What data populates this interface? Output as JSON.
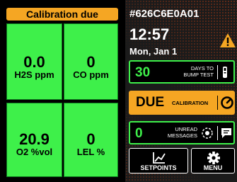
{
  "status_banner": "Calibration due",
  "sensors": [
    {
      "value": "0.0",
      "unit": "H2S ppm"
    },
    {
      "value": "0",
      "unit": "CO ppm"
    },
    {
      "value": "20.9",
      "unit": "O2 %vol"
    },
    {
      "value": "0",
      "unit": "LEL %"
    }
  ],
  "device_id": "#626C6E0A01",
  "time": "12:57",
  "date": "Mon, Jan 1",
  "bump": {
    "days": "30",
    "label_line1": "DAYS TO",
    "label_line2": "BUMP TEST"
  },
  "calibration": {
    "status": "DUE",
    "label": "CALIBRATION"
  },
  "messages": {
    "count": "0",
    "label_line1": "UNREAD",
    "label_line2": "MESSAGES"
  },
  "buttons": {
    "setpoints": "SETPOINTS",
    "menu": "MENU"
  },
  "colors": {
    "ok": "#3ef04a",
    "warn": "#f5a623",
    "alert_pattern": "#e64614"
  },
  "icons": [
    "warning-icon",
    "bump-test-icon",
    "gauge-icon",
    "beacon-icon",
    "message-icon",
    "setpoints-chart-icon",
    "gear-icon"
  ]
}
